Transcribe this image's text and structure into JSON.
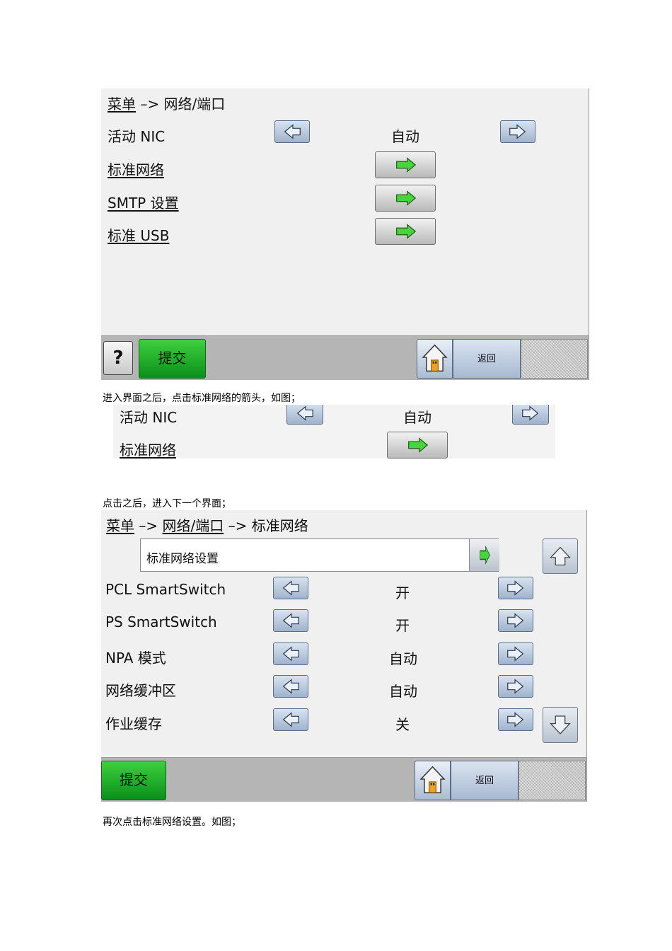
{
  "screen1": {
    "breadcrumb": {
      "menu": "菜单",
      "arrow": "–>",
      "current": "网络/端口"
    },
    "active_nic": {
      "label": "活动 NIC",
      "value": "自动"
    },
    "items": [
      "标准网络",
      "SMTP 设置",
      "标准 USB"
    ],
    "bottom": {
      "help": "?",
      "submit": "提交",
      "back": "返回"
    }
  },
  "caption1": "进入界面之后，点击标准网络的箭头，如图；",
  "crop": {
    "active_nic_label": "活动 NIC",
    "active_nic_value": "自动",
    "item": "标准网络"
  },
  "caption2": "点击之后，进入下一个界面；",
  "screen2": {
    "breadcrumb": {
      "menu": "菜单",
      "arrow1": "–>",
      "mid": "网络/端口",
      "arrow2": "–>",
      "current": "标准网络"
    },
    "field": "标准网络设置",
    "settings": [
      {
        "label": "PCL SmartSwitch",
        "value": "开"
      },
      {
        "label": "PS SmartSwitch",
        "value": "开"
      },
      {
        "label": "NPA 模式",
        "value": "自动"
      },
      {
        "label": "网络缓冲区",
        "value": "自动"
      },
      {
        "label": "作业缓存",
        "value": "关"
      }
    ],
    "bottom": {
      "submit": "提交",
      "back": "返回"
    }
  },
  "caption3": "再次点击标准网络设置。如图；",
  "icons": [
    "left-arrow-icon",
    "right-arrow-icon",
    "green-arrow-icon",
    "home-icon",
    "up-arrow-icon",
    "down-arrow-icon",
    "help-icon"
  ],
  "colors": {
    "submit_green": "#1aa82a",
    "nav_blue": "#b7c8de",
    "panel_bg": "#f0f0f0",
    "bar_gray": "#b5b5b5"
  }
}
